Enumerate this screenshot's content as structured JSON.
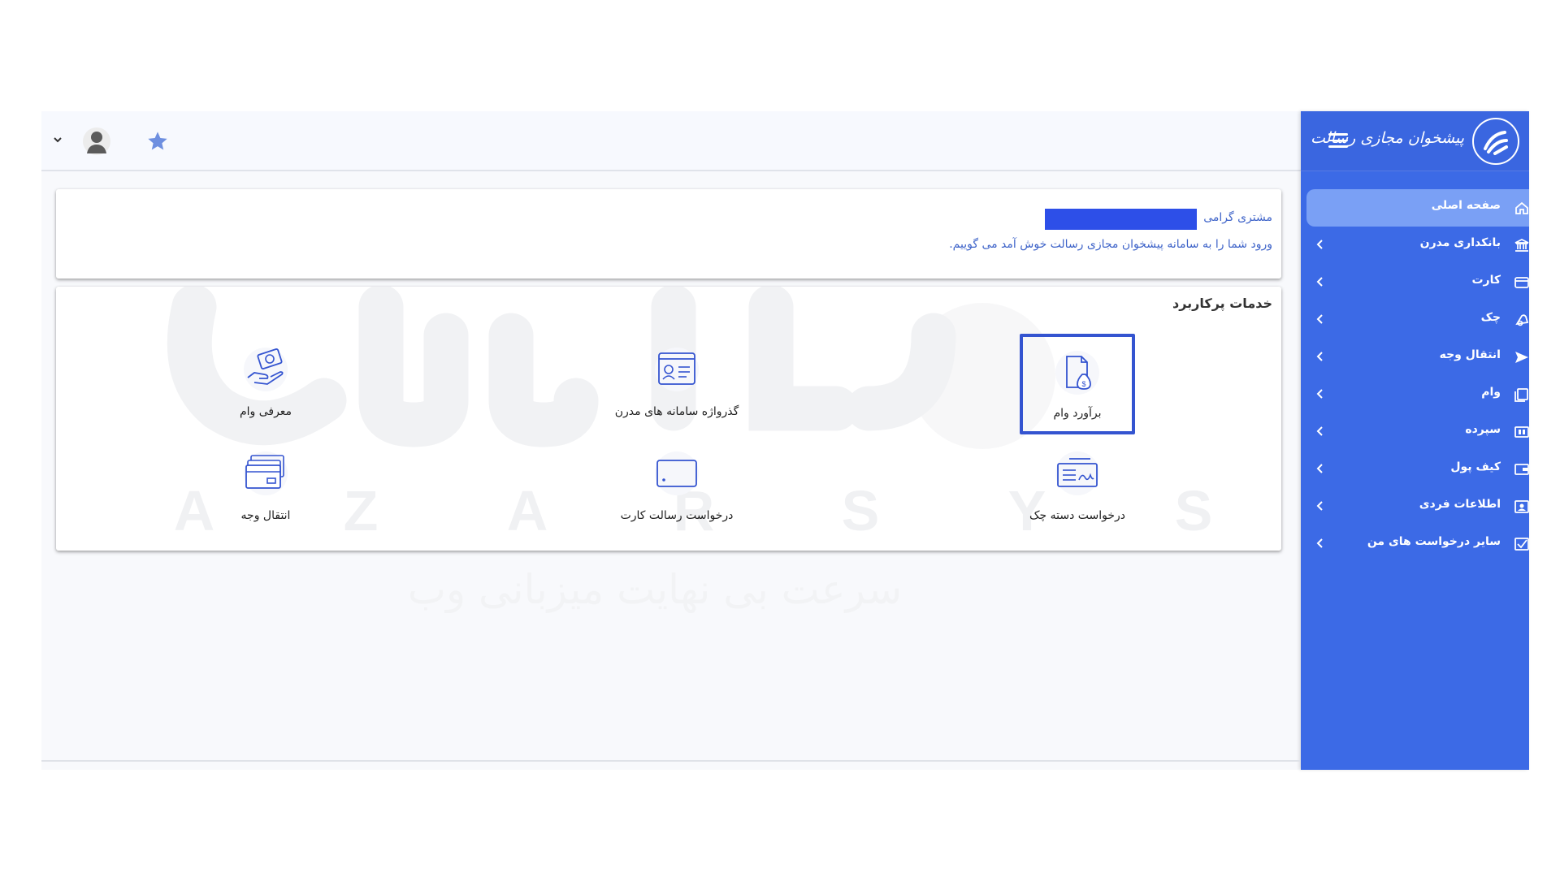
{
  "app": {
    "logo_text": "پیشخوان مجازی رسالت"
  },
  "colors": {
    "sidebar": "#3c6ae6",
    "active_item": "#7aa0f5",
    "accent": "#3454d0",
    "star": "#6e8fe0"
  },
  "sidebar": {
    "items": [
      {
        "label": "صفحه اصلی",
        "icon": "home-icon",
        "active": true
      },
      {
        "label": "بانکداری مدرن",
        "icon": "bank-icon"
      },
      {
        "label": "کارت",
        "icon": "card-icon"
      },
      {
        "label": "چک",
        "icon": "check-icon"
      },
      {
        "label": "انتقال وجه",
        "icon": "send-icon"
      },
      {
        "label": "وام",
        "icon": "loan-icon"
      },
      {
        "label": "سپرده",
        "icon": "deposit-icon"
      },
      {
        "label": "کیف پول",
        "icon": "wallet-icon"
      },
      {
        "label": "اطلاعات فردی",
        "icon": "profile-icon"
      },
      {
        "label": "سایر درخواست های من",
        "icon": "requests-icon"
      }
    ]
  },
  "welcome": {
    "greeting": "مشتری گرامی",
    "message": "ورود شما را به سامانه پیشخوان مجازی رسالت خوش آمد می گوییم."
  },
  "services": {
    "title": "خدمات پرکاربرد",
    "items": [
      {
        "label": "برآورد وام",
        "icon": "loan-estimate-icon",
        "selected": true
      },
      {
        "label": "گذرواژه سامانه های مدرن",
        "icon": "password-id-icon"
      },
      {
        "label": "معرفی وام",
        "icon": "loan-intro-icon"
      },
      {
        "label": "درخواست دسته چک",
        "icon": "checkbook-icon"
      },
      {
        "label": "درخواست رسالت کارت",
        "icon": "card-request-icon"
      },
      {
        "label": "انتقال وجه",
        "icon": "transfer-cards-icon"
      }
    ]
  },
  "watermark": {
    "brand": "AZARSYS",
    "letters": [
      "A",
      "Z",
      "A",
      "R",
      "S",
      "Y",
      "S"
    ],
    "tagline": "سرعت بی نهایت میزبانی وب"
  }
}
